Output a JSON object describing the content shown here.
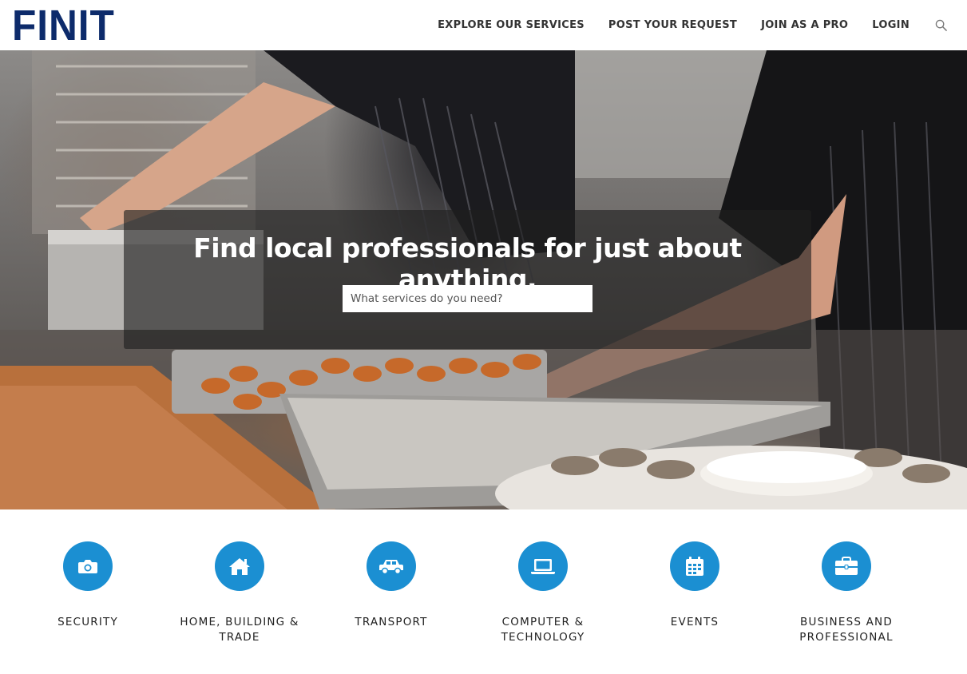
{
  "header": {
    "logo": "FINIT",
    "nav": [
      {
        "label": "EXPLORE OUR SERVICES"
      },
      {
        "label": "POST YOUR REQUEST"
      },
      {
        "label": "JOIN AS A PRO"
      },
      {
        "label": "LOGIN"
      }
    ],
    "search_icon": "search-icon"
  },
  "hero": {
    "title": "Find local professionals for just about anything.",
    "search_placeholder": "What services do you need?",
    "search_value": ""
  },
  "categories": [
    {
      "label": "SECURITY",
      "icon": "camera-icon"
    },
    {
      "label": "HOME, BUILDING & TRADE",
      "icon": "house-icon"
    },
    {
      "label": "TRANSPORT",
      "icon": "car-icon"
    },
    {
      "label": "COMPUTER & TECHNOLOGY",
      "icon": "laptop-icon"
    },
    {
      "label": "EVENTS",
      "icon": "calendar-icon"
    },
    {
      "label": "BUSINESS AND PROFESSIONAL",
      "icon": "briefcase-icon"
    }
  ],
  "colors": {
    "brand": "#0d2b6b",
    "accent": "#1b8fd2"
  }
}
